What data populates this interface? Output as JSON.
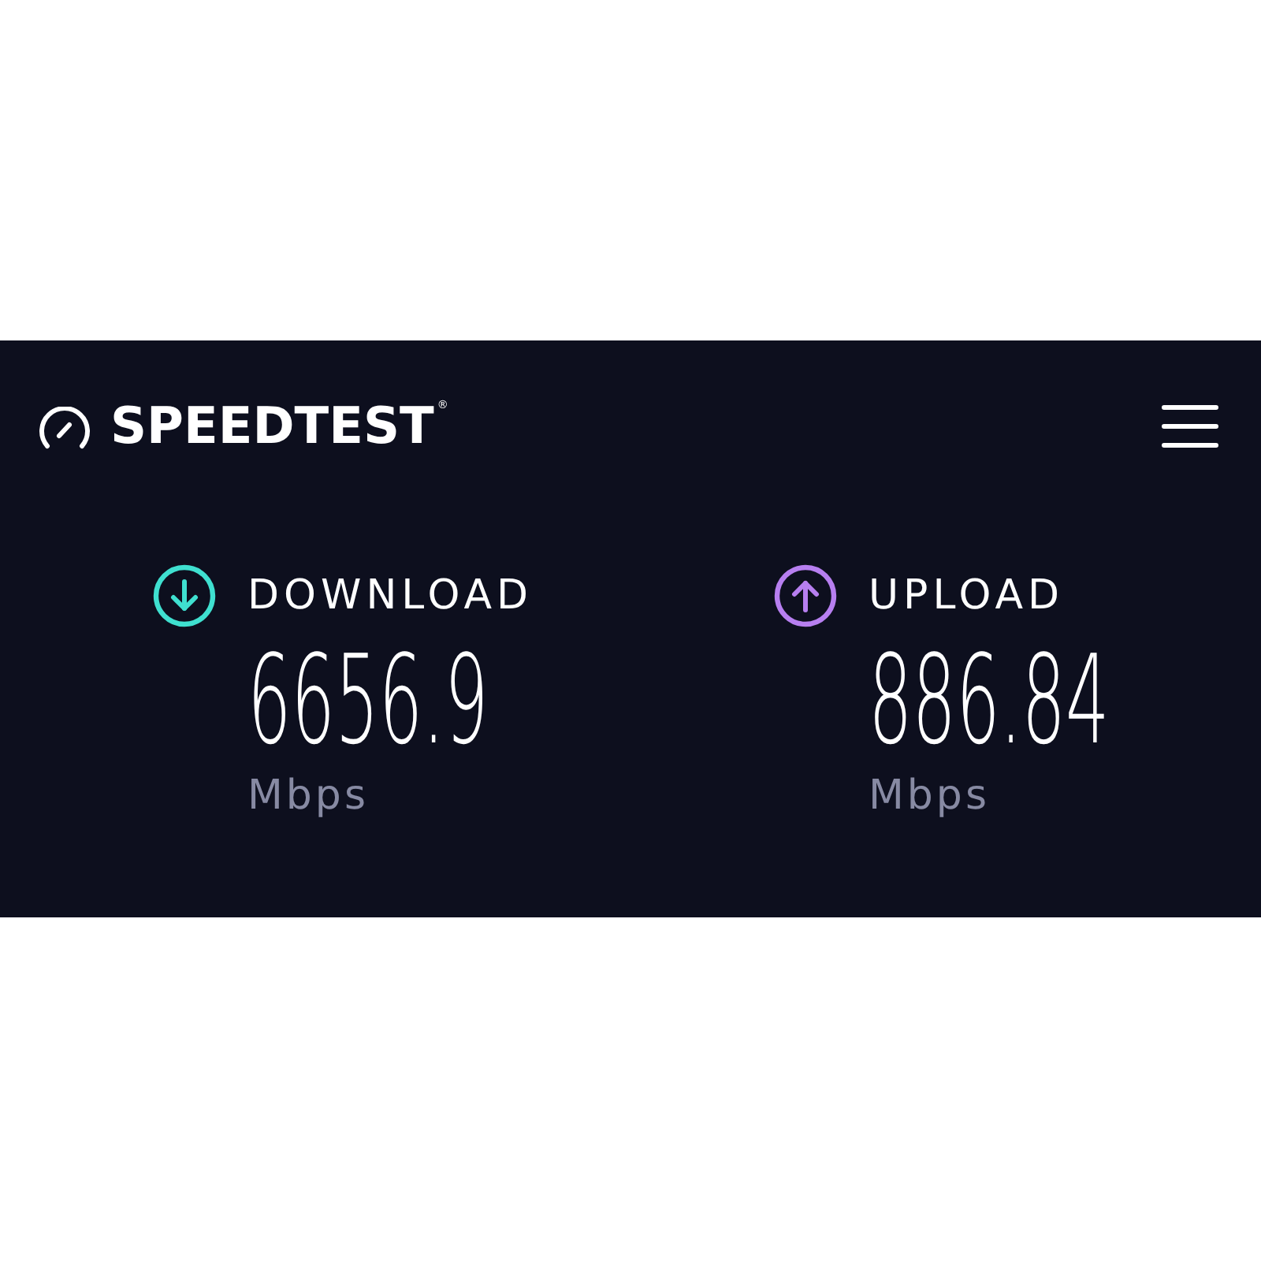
{
  "header": {
    "logo_text": "SPEEDTEST$^{®}$"
  },
  "results": [
    {
      "kind": "download",
      "label": "DOWNLOAD",
      "value": "6656.9",
      "unit": "Mbps",
      "color": "#3fe0d0"
    },
    {
      "kind": "upload",
      "label": "UPLOAD",
      "value": "886.84",
      "unit": "Mbps",
      "color": "#b77ff0"
    }
  ]
}
